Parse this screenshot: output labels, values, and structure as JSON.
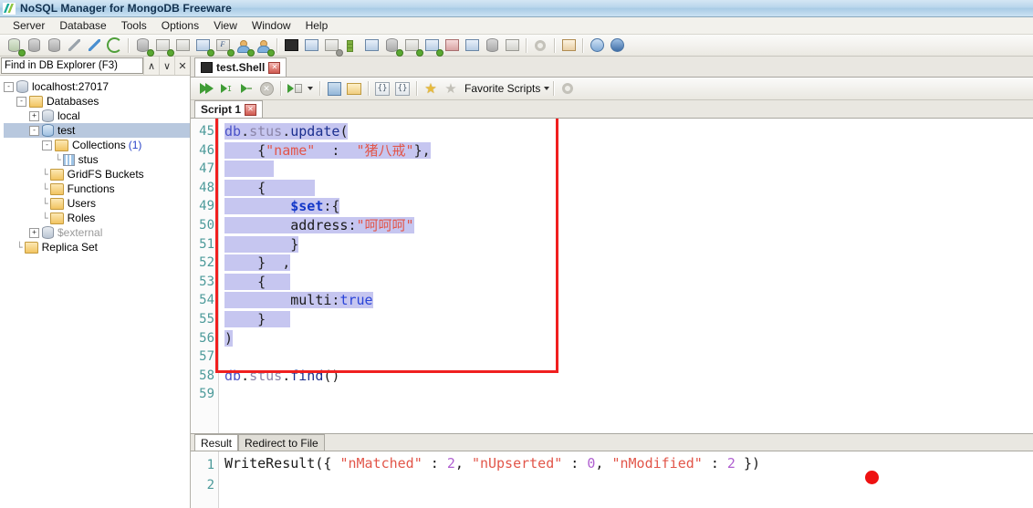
{
  "window": {
    "title": "NoSQL Manager for MongoDB Freeware",
    "icon": "app-logo-icon"
  },
  "menubar": {
    "items": [
      {
        "label": "Server"
      },
      {
        "label": "Database"
      },
      {
        "label": "Tools"
      },
      {
        "label": "Options"
      },
      {
        "label": "View"
      },
      {
        "label": "Window"
      },
      {
        "label": "Help"
      }
    ]
  },
  "toolbar": {
    "icons": [
      "connect-icon",
      "disconnect-icon",
      "disconnect-all-icon",
      "edit-connection-icon",
      "new-connection-icon",
      "refresh-icon",
      "new-database-icon",
      "new-collection-icon",
      "drop-collection-icon",
      "new-document-icon",
      "new-function-icon",
      "new-user-icon",
      "new-role-icon",
      "shell-icon",
      "query-builder-icon",
      "aggregation-icon",
      "index-manager-icon",
      "duplicate-icon",
      "import-icon",
      "export-icon",
      "backup-icon",
      "restore-icon",
      "transfer-icon",
      "statistics-icon",
      "grid-icon",
      "options-gear-icon",
      "home-icon",
      "help-icon",
      "about-icon"
    ]
  },
  "explorer": {
    "find": {
      "value": "Find in DB Explorer (F3)",
      "placeholder": "Find in DB Explorer (F3)"
    },
    "buttons": [
      {
        "name": "find-prev-button",
        "glyph": "∧"
      },
      {
        "name": "find-next-button",
        "glyph": "∨"
      },
      {
        "name": "find-close-button",
        "glyph": "✕"
      }
    ],
    "tree": [
      {
        "label": "localhost:27017",
        "icon": "server-icon",
        "expander": "-",
        "depth": 0,
        "selected": false,
        "dim": false,
        "count": ""
      },
      {
        "label": "Databases",
        "icon": "folder-icon",
        "expander": "-",
        "depth": 1,
        "selected": false,
        "dim": false,
        "count": ""
      },
      {
        "label": "local",
        "icon": "database-icon",
        "expander": "+",
        "depth": 2,
        "selected": false,
        "dim": false,
        "count": ""
      },
      {
        "label": "test",
        "icon": "database-icon",
        "expander": "-",
        "depth": 2,
        "selected": true,
        "dim": false,
        "count": ""
      },
      {
        "label": "Collections",
        "icon": "folder-icon",
        "expander": "-",
        "depth": 3,
        "selected": false,
        "dim": false,
        "count": "(1)"
      },
      {
        "label": "stus",
        "icon": "collection-icon",
        "expander": "",
        "depth": 4,
        "selected": false,
        "dim": false,
        "count": ""
      },
      {
        "label": "GridFS Buckets",
        "icon": "folder-icon",
        "expander": "",
        "depth": 3,
        "selected": false,
        "dim": false,
        "count": ""
      },
      {
        "label": "Functions",
        "icon": "folder-icon",
        "expander": "",
        "depth": 3,
        "selected": false,
        "dim": false,
        "count": ""
      },
      {
        "label": "Users",
        "icon": "folder-icon",
        "expander": "",
        "depth": 3,
        "selected": false,
        "dim": false,
        "count": ""
      },
      {
        "label": "Roles",
        "icon": "folder-icon",
        "expander": "",
        "depth": 3,
        "selected": false,
        "dim": false,
        "count": ""
      },
      {
        "label": "$external",
        "icon": "database-icon",
        "expander": "+",
        "depth": 2,
        "selected": false,
        "dim": true,
        "count": ""
      },
      {
        "label": "Replica Set",
        "icon": "folder-icon",
        "expander": "",
        "depth": 1,
        "selected": false,
        "dim": false,
        "count": ""
      }
    ]
  },
  "shell": {
    "tab": {
      "label": "test.Shell",
      "icon": "shell-icon",
      "close": "✕"
    },
    "toolbar": {
      "run_all": "run-all-icon",
      "run_current": "run-current-icon",
      "run_to_cursor": "run-to-cursor-icon",
      "stop": "stop-icon",
      "run_mode": "run-mode-icon",
      "save": "save-icon",
      "open": "open-icon",
      "format": "format-icon",
      "unformat": "unformat-icon",
      "add_favorite": "add-favorite-star-icon",
      "remove_favorite": "remove-favorite-star-icon",
      "favorite_scripts_label": "Favorite Scripts",
      "settings": "settings-gear-icon"
    },
    "script_tab": {
      "label": "Script 1",
      "close": "✕"
    }
  },
  "code": {
    "first_line_number": 45,
    "lines": [
      {
        "n": 45,
        "indent": 0,
        "tokens": [
          {
            "t": "db",
            "c": "t-db",
            "sel": true
          },
          {
            "t": ".",
            "c": "t-punct",
            "sel": true
          },
          {
            "t": "stus",
            "c": "t-coll",
            "sel": true
          },
          {
            "t": ".",
            "c": "t-punct",
            "sel": true
          },
          {
            "t": "update",
            "c": "t-fn",
            "sel": true
          },
          {
            "t": "(",
            "c": "t-punct",
            "sel": true
          }
        ]
      },
      {
        "n": 46,
        "indent": 0,
        "tokens": [
          {
            "t": "    ",
            "c": "t-plain",
            "sel": true
          },
          {
            "t": "{",
            "c": "t-punct",
            "sel": true
          },
          {
            "t": "\"name\"",
            "c": "t-str",
            "sel": true
          },
          {
            "t": "  :  ",
            "c": "t-punct",
            "sel": true
          },
          {
            "t": "\"猪八戒\"",
            "c": "t-str",
            "sel": true
          },
          {
            "t": "}",
            "c": "t-punct",
            "sel": true
          },
          {
            "t": ",",
            "c": "t-punct",
            "sel": true
          }
        ]
      },
      {
        "n": 47,
        "indent": 0,
        "tokens": [
          {
            "t": "      ",
            "c": "t-plain",
            "sel": true
          }
        ]
      },
      {
        "n": 48,
        "indent": 0,
        "tokens": [
          {
            "t": "    ",
            "c": "t-plain",
            "sel": true
          },
          {
            "t": "{",
            "c": "t-punct",
            "sel": true
          },
          {
            "t": "      ",
            "c": "t-plain",
            "sel": true
          }
        ]
      },
      {
        "n": 49,
        "indent": 0,
        "tokens": [
          {
            "t": "        ",
            "c": "t-plain",
            "sel": true
          },
          {
            "t": "$set",
            "c": "t-key",
            "sel": true
          },
          {
            "t": ":{",
            "c": "t-punct",
            "sel": true
          }
        ]
      },
      {
        "n": 50,
        "indent": 0,
        "tokens": [
          {
            "t": "        ",
            "c": "t-plain",
            "sel": true
          },
          {
            "t": "address",
            "c": "t-plain",
            "sel": true
          },
          {
            "t": ":",
            "c": "t-punct",
            "sel": true
          },
          {
            "t": "\"呵呵呵\"",
            "c": "t-str",
            "sel": true
          }
        ]
      },
      {
        "n": 51,
        "indent": 0,
        "tokens": [
          {
            "t": "        ",
            "c": "t-plain",
            "sel": true
          },
          {
            "t": "}",
            "c": "t-punct",
            "sel": true
          }
        ]
      },
      {
        "n": 52,
        "indent": 0,
        "tokens": [
          {
            "t": "    ",
            "c": "t-plain",
            "sel": true
          },
          {
            "t": "}",
            "c": "t-punct",
            "sel": true
          },
          {
            "t": "  ,",
            "c": "t-punct",
            "sel": true
          }
        ]
      },
      {
        "n": 53,
        "indent": 0,
        "tokens": [
          {
            "t": "    ",
            "c": "t-plain",
            "sel": true
          },
          {
            "t": "{",
            "c": "t-punct",
            "sel": true
          },
          {
            "t": "   ",
            "c": "t-plain",
            "sel": true
          }
        ]
      },
      {
        "n": 54,
        "indent": 0,
        "tokens": [
          {
            "t": "        ",
            "c": "t-plain",
            "sel": true
          },
          {
            "t": "multi",
            "c": "t-plain",
            "sel": true
          },
          {
            "t": ":",
            "c": "t-punct",
            "sel": true
          },
          {
            "t": "true",
            "c": "t-bool",
            "sel": true
          }
        ]
      },
      {
        "n": 55,
        "indent": 0,
        "tokens": [
          {
            "t": "    ",
            "c": "t-plain",
            "sel": true
          },
          {
            "t": "}",
            "c": "t-punct",
            "sel": true
          },
          {
            "t": "   ",
            "c": "t-plain",
            "sel": true
          }
        ]
      },
      {
        "n": 56,
        "indent": 0,
        "tokens": [
          {
            "t": ")",
            "c": "t-punct",
            "sel": true
          }
        ]
      },
      {
        "n": 57,
        "indent": 0,
        "tokens": []
      },
      {
        "n": 58,
        "indent": 0,
        "tokens": [
          {
            "t": "db",
            "c": "t-db",
            "sel": false
          },
          {
            "t": ".",
            "c": "t-punct",
            "sel": false
          },
          {
            "t": "stus",
            "c": "t-coll",
            "sel": false
          },
          {
            "t": ".",
            "c": "t-punct",
            "sel": false
          },
          {
            "t": "find",
            "c": "t-fn",
            "sel": false
          },
          {
            "t": "()",
            "c": "t-punct",
            "sel": false
          }
        ]
      },
      {
        "n": 59,
        "indent": 0,
        "tokens": []
      }
    ]
  },
  "annotation": {
    "box_color": "#f01f1f",
    "cursor_color": "#ee1111"
  },
  "result": {
    "tabs": [
      {
        "label": "Result",
        "active": true
      },
      {
        "label": "Redirect to File",
        "active": false
      }
    ],
    "lines": [
      {
        "n": 1,
        "parts": [
          {
            "t": "WriteResult({ ",
            "c": ""
          },
          {
            "t": "\"nMatched\"",
            "c": "k"
          },
          {
            "t": " : ",
            "c": ""
          },
          {
            "t": "2",
            "c": "n"
          },
          {
            "t": ", ",
            "c": ""
          },
          {
            "t": "\"nUpserted\"",
            "c": "k"
          },
          {
            "t": " : ",
            "c": ""
          },
          {
            "t": "0",
            "c": "n"
          },
          {
            "t": ", ",
            "c": ""
          },
          {
            "t": "\"nModified\"",
            "c": "k"
          },
          {
            "t": " : ",
            "c": ""
          },
          {
            "t": "2",
            "c": "n"
          },
          {
            "t": " })",
            "c": ""
          }
        ]
      },
      {
        "n": 2,
        "parts": []
      }
    ]
  }
}
